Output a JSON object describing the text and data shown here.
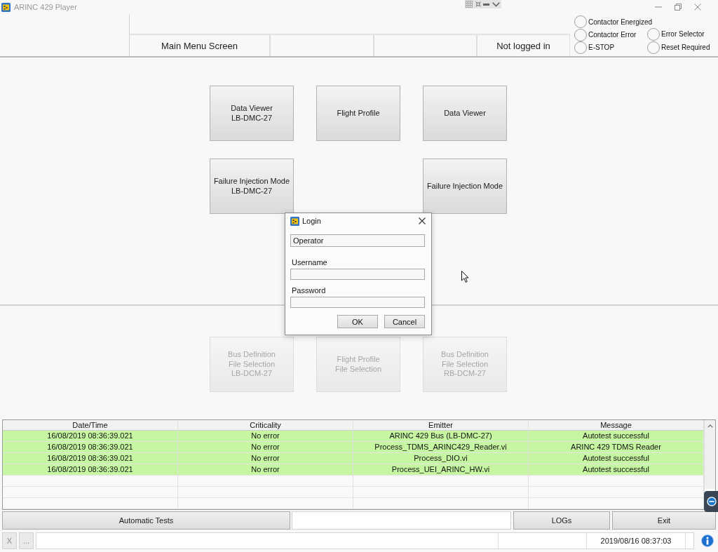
{
  "window": {
    "title": "ARINC 429 Player"
  },
  "header": {
    "screen_title": "Main Menu Screen",
    "login_status": "Not logged in"
  },
  "indicators": {
    "column_1": [
      {
        "label": "Contactor Energized",
        "on": false
      },
      {
        "label": "Contactor Error",
        "on": false
      },
      {
        "label": "E-STOP",
        "on": false
      }
    ],
    "column_2": [
      {
        "label": "Error Selector",
        "on": false
      },
      {
        "label": "Reset Required",
        "on": false
      }
    ]
  },
  "menu": {
    "rows": [
      {
        "buttons": [
          {
            "label": "Data Viewer\nLB-DMC-27",
            "disabled": false
          },
          {
            "label": "Flight Profile",
            "disabled": false
          },
          {
            "label": "Data Viewer",
            "disabled": false
          }
        ]
      },
      {
        "buttons": [
          {
            "label": "Failure Injection Mode\nLB-DMC-27",
            "disabled": false
          },
          {
            "label": "Failure Injection Mode",
            "disabled": false
          }
        ]
      }
    ]
  },
  "file_selection": {
    "buttons": [
      {
        "label": "Bus Definition\nFile Selection\nLB-DCM-27",
        "disabled": true
      },
      {
        "label": "Flight Profile\nFile Selection",
        "disabled": true
      },
      {
        "label": "Bus Definition\nFile Selection\nRB-DCM-27",
        "disabled": true
      }
    ]
  },
  "login_dialog": {
    "title": "Login",
    "role_field": {
      "value": "Operator"
    },
    "fields": [
      {
        "label": "Username"
      },
      {
        "label": "Password"
      }
    ],
    "buttons": [
      "OK",
      "Cancel"
    ]
  },
  "log_table": {
    "columns": [
      "Date/Time",
      "Criticality",
      "Emitter",
      "Message"
    ],
    "rows": [
      {
        "cells": [
          "16/08/2019 08:36:39.021",
          "No error",
          "ARINC 429 Bus (LB-DMC-27)",
          "Autotest successful"
        ],
        "color": "#c6f6a1"
      },
      {
        "cells": [
          "16/08/2019 08:36:39.021",
          "No error",
          "Process_TDMS_ARINC429_Reader.vi",
          "ARINC 429 TDMS Reader"
        ],
        "color": "#c6f6a1"
      },
      {
        "cells": [
          "16/08/2019 08:36:39.021",
          "No error",
          "Process_DIO.vi",
          "Autotest successful"
        ],
        "color": "#c6f6a1"
      },
      {
        "cells": [
          "16/08/2019 08:36:39.021",
          "No error",
          "Process_UEI_ARINC_HW.vi",
          "Autotest successful"
        ],
        "color": "#c6f6a1"
      }
    ]
  },
  "actions": {
    "left": [
      "Automatic Tests"
    ],
    "right": [
      "LOGs",
      "Exit"
    ]
  },
  "status_bar": {
    "buttons": [
      "X",
      "..."
    ],
    "datetime": "2019/08/16 08:37:03"
  }
}
